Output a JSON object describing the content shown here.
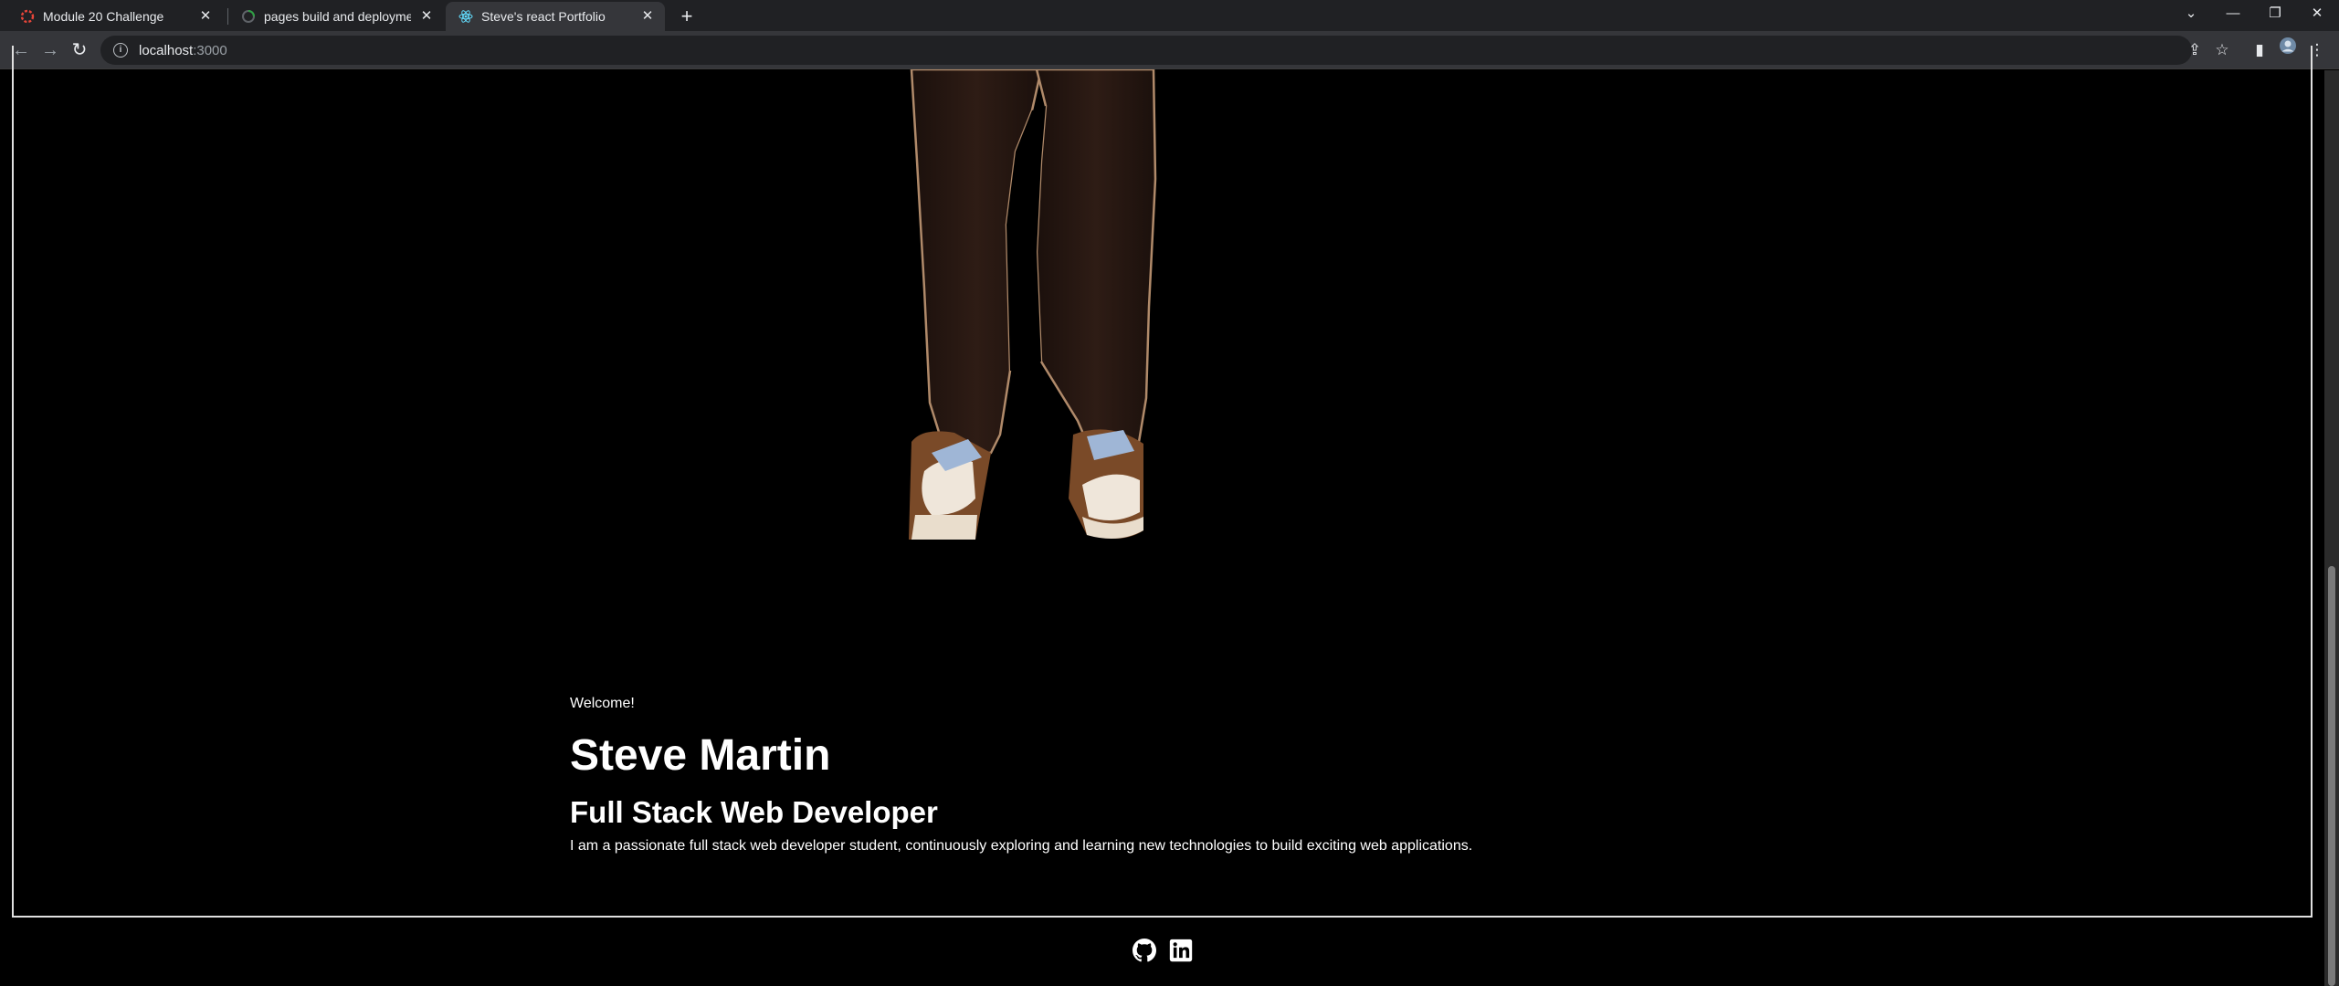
{
  "browser": {
    "tabs": [
      {
        "title": "Module 20 Challenge",
        "icon": "challenge-favicon",
        "active": false
      },
      {
        "title": "pages build and deployment · W",
        "icon": "github-actions-favicon",
        "active": false
      },
      {
        "title": "Steve's react Portfolio",
        "icon": "react-favicon",
        "active": true
      }
    ],
    "address": {
      "host": "localhost",
      "port": ":3000"
    }
  },
  "hero": {
    "welcome": "Welcome!",
    "name": "Steve Martin",
    "role": "Full Stack Web Developer",
    "bio": "I am a passionate full stack web developer student, continuously exploring and learning new technologies to build exciting web applications."
  },
  "footer": {
    "links": [
      {
        "icon": "github-icon"
      },
      {
        "icon": "linkedin-icon"
      }
    ]
  },
  "colors": {
    "page_bg": "#000000",
    "text": "#ffffff",
    "tabbar_bg": "#202124",
    "toolbar_bg": "#35363a",
    "hero_border": "#e0e0e0",
    "pants": "#2a1a14",
    "shoe_brown": "#7a4a28",
    "shoe_cream": "#efe6da",
    "laces": "#9fb6d6"
  }
}
